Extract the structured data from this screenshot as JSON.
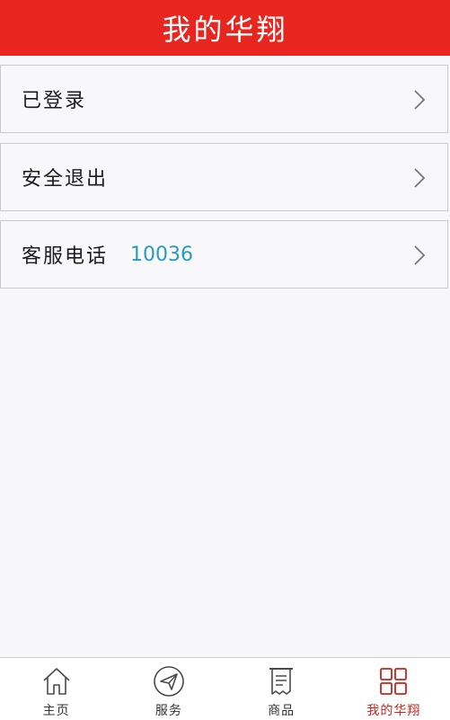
{
  "header": {
    "title": "我的华翔"
  },
  "menu": {
    "items": [
      {
        "label": "已登录",
        "value": ""
      },
      {
        "label": "安全退出",
        "value": ""
      },
      {
        "label": "客服电话",
        "value": "10036"
      }
    ]
  },
  "tabbar": {
    "tabs": [
      {
        "label": "主页",
        "icon": "home-icon"
      },
      {
        "label": "服务",
        "icon": "send-icon"
      },
      {
        "label": "商品",
        "icon": "receipt-icon"
      },
      {
        "label": "我的华翔",
        "icon": "grid-icon"
      }
    ],
    "active_index": 3
  },
  "colors": {
    "header_bg": "#e8261f",
    "accent_value": "#2a9bc0",
    "active_tab": "#c8241c",
    "icon_stroke": "#4a4a4a"
  }
}
